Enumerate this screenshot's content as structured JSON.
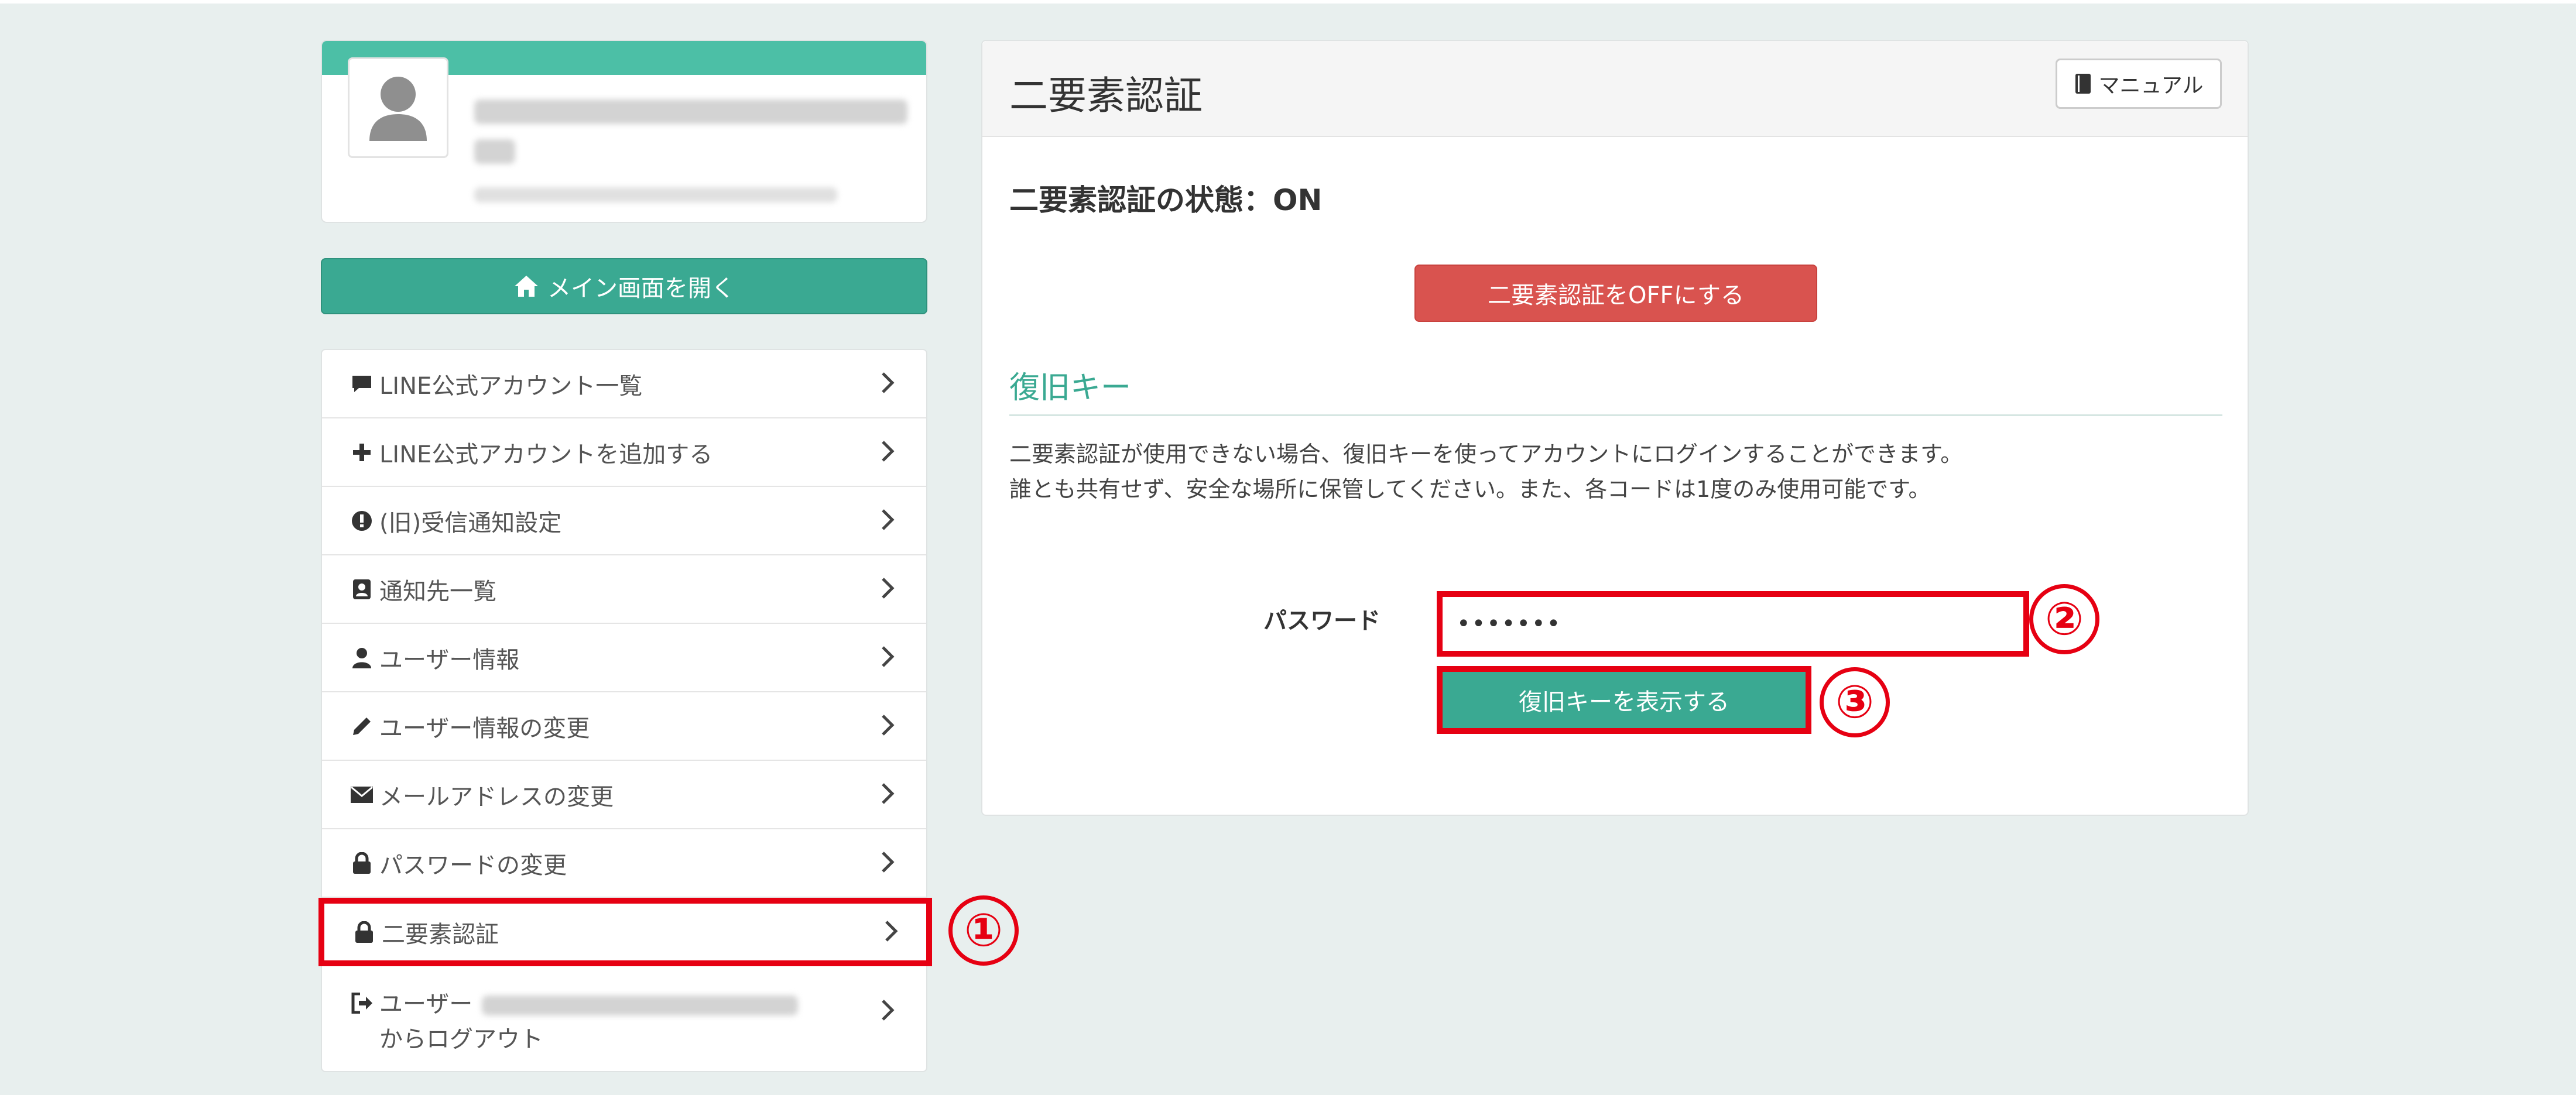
{
  "profile": {
    "name": "",
    "sub": ""
  },
  "main_button": {
    "label": "メイン画面を開く"
  },
  "menu": {
    "items": [
      {
        "label": "LINE公式アカウント一覧",
        "icon": "comment-icon"
      },
      {
        "label": "LINE公式アカウントを追加する",
        "icon": "plus-icon"
      },
      {
        "label": "(旧)受信通知設定",
        "icon": "exclamation-circle-icon"
      },
      {
        "label": "通知先一覧",
        "icon": "contact-card-icon"
      },
      {
        "label": "ユーザー情報",
        "icon": "user-icon"
      },
      {
        "label": "ユーザー情報の変更",
        "icon": "pencil-icon"
      },
      {
        "label": "メールアドレスの変更",
        "icon": "envelope-icon"
      },
      {
        "label": "パスワードの変更",
        "icon": "lock-icon"
      },
      {
        "label": "二要素認証",
        "icon": "lock-icon"
      }
    ],
    "logout": {
      "label_line1": "ユーザー",
      "label_line2": "からログアウト",
      "icon": "sign-out-icon"
    }
  },
  "panel": {
    "title": "二要素認証",
    "manual_label": "マニュアル",
    "status": "二要素認証の状態：ON",
    "off_button": "二要素認証をOFFにする",
    "section_title": "復旧キー",
    "desc_line1": "二要素認証が使用できない場合、復旧キーを使ってアカウントにログインすることができます。",
    "desc_line2": "誰とも共有せず、安全な場所に保管してください。また、各コードは1度のみ使用可能です。",
    "password_label": "パスワード",
    "password_value": "•••••••",
    "show_button": "復旧キーを表示する"
  },
  "callouts": [
    "①",
    "②",
    "③"
  ],
  "colors": {
    "brand": "#3aa992",
    "header_bar": "#4cbfa6",
    "danger": "#d9534f",
    "highlight": "#e60012",
    "background": "#e8efee"
  }
}
